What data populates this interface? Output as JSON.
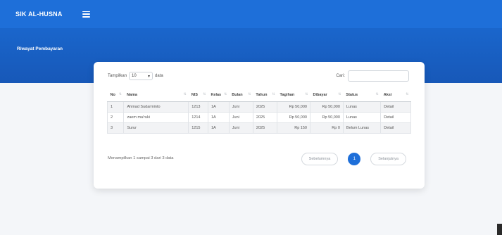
{
  "app": {
    "brand": "SIK AL-HUSNA"
  },
  "hero": {
    "title": "Riwayat Pembayaran"
  },
  "datatable": {
    "length_prefix": "Tampilkan",
    "length_value": "10",
    "length_suffix": "data",
    "search_label": "Cari:",
    "search_value": "",
    "columns": [
      "No",
      "Nama",
      "NIS",
      "Kelas",
      "Bulan",
      "Tahun",
      "Tagihan",
      "Dibayar",
      "Status",
      "Aksi"
    ],
    "rows": [
      {
        "no": "1",
        "nama": "Ahmad Sudarminto",
        "nis": "1213",
        "kelas": "1A",
        "bulan": "Juni",
        "tahun": "2025",
        "tagihan": "Rp 50,000",
        "dibayar": "Rp 50,000",
        "status": "Lunas",
        "aksi": "Detail"
      },
      {
        "no": "2",
        "nama": "zaem ma'ruki",
        "nis": "1214",
        "kelas": "1A",
        "bulan": "Juni",
        "tahun": "2025",
        "tagihan": "Rp 50,000",
        "dibayar": "Rp 50,000",
        "status": "Lunas",
        "aksi": "Detail"
      },
      {
        "no": "3",
        "nama": "Surur",
        "nis": "1215",
        "kelas": "1A",
        "bulan": "Juni",
        "tahun": "2025",
        "tagihan": "Rp 150",
        "dibayar": "Rp 0",
        "status": "Belum Lunas",
        "aksi": "Detail"
      }
    ],
    "info": "Menampilkan 1 sampai 3 dari 3 data",
    "pagination": {
      "prev": "Sebelumnya",
      "current": "1",
      "next": "Selanjutnya"
    }
  },
  "colors": {
    "primary": "#1e6fd9",
    "hero": "#1a66cc"
  },
  "icons": {
    "menu": "hamburger-icon",
    "dropdown": "chevron-down-icon",
    "sort": "sort-icon"
  }
}
